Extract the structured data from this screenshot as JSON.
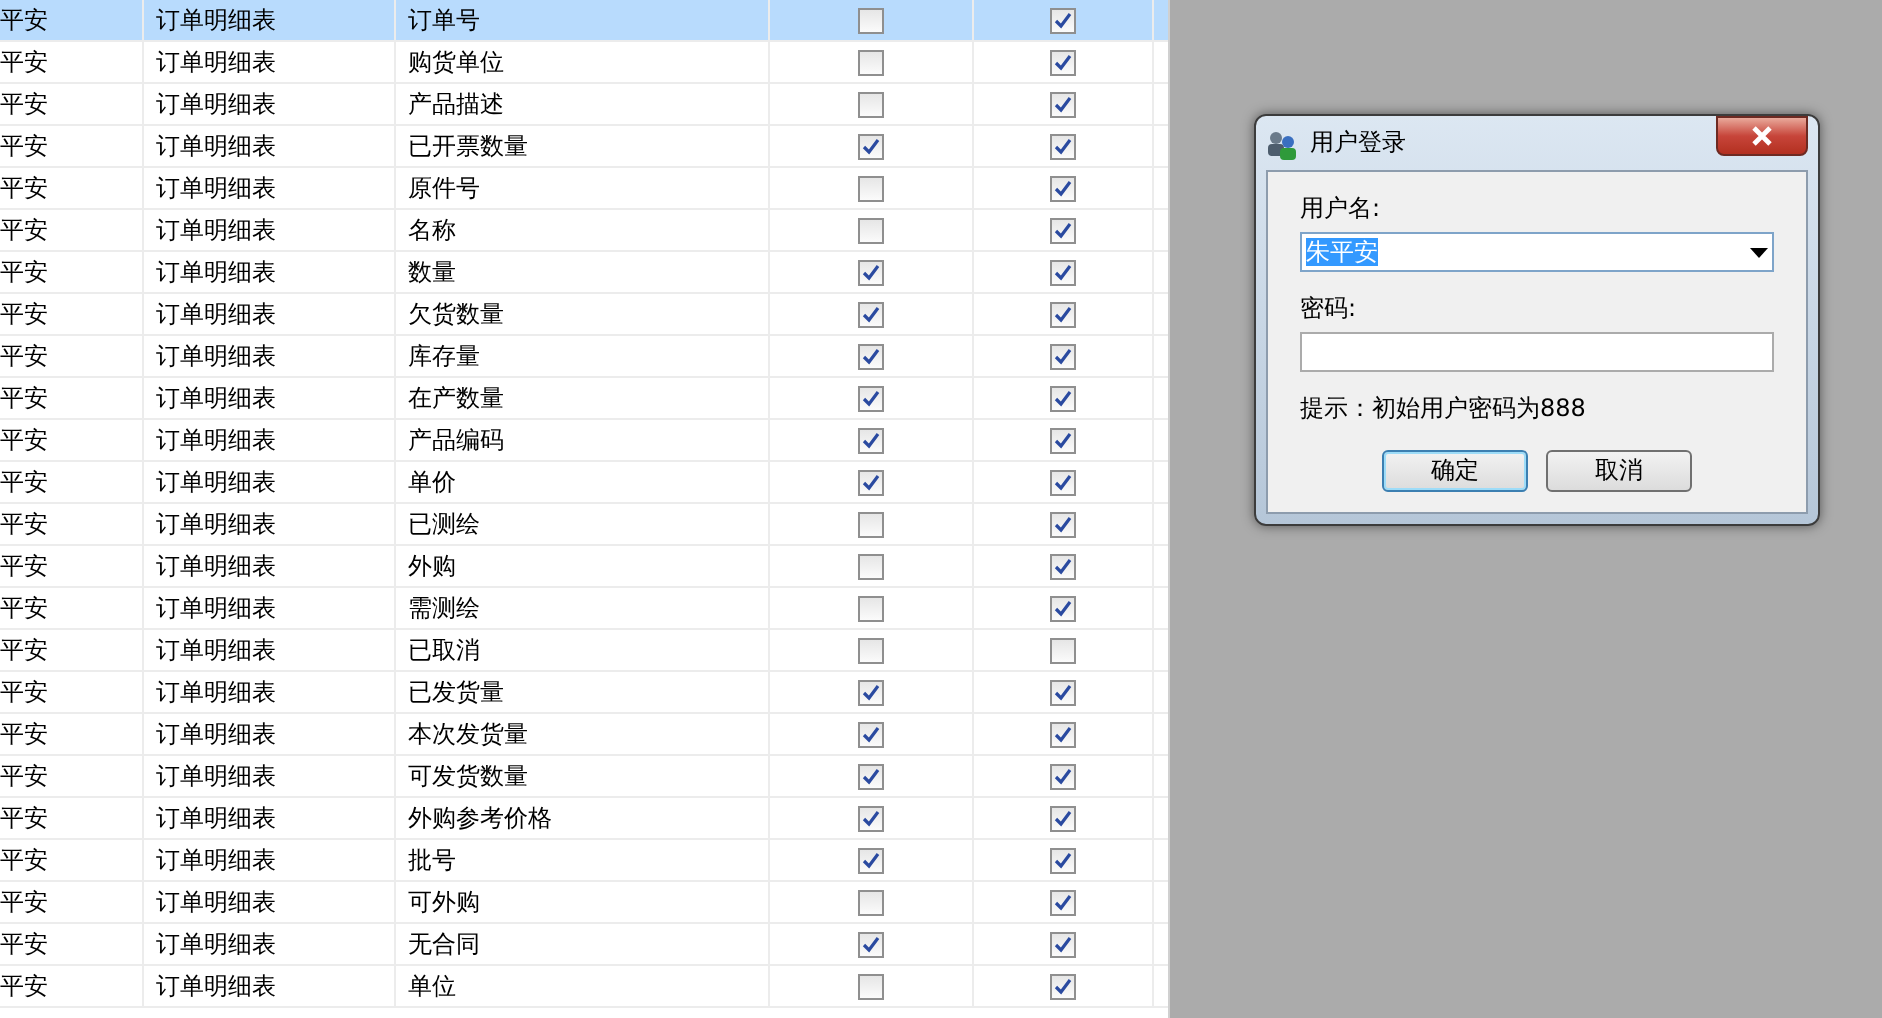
{
  "table": {
    "rows": [
      {
        "user": "平安",
        "table": "订单明细表",
        "field": "订单号",
        "check_1": false,
        "check_2": true,
        "selected": true
      },
      {
        "user": "平安",
        "table": "订单明细表",
        "field": "购货单位",
        "check_1": false,
        "check_2": true,
        "selected": false
      },
      {
        "user": "平安",
        "table": "订单明细表",
        "field": "产品描述",
        "check_1": false,
        "check_2": true,
        "selected": false
      },
      {
        "user": "平安",
        "table": "订单明细表",
        "field": "已开票数量",
        "check_1": true,
        "check_2": true,
        "selected": false
      },
      {
        "user": "平安",
        "table": "订单明细表",
        "field": "原件号",
        "check_1": false,
        "check_2": true,
        "selected": false
      },
      {
        "user": "平安",
        "table": "订单明细表",
        "field": "名称",
        "check_1": false,
        "check_2": true,
        "selected": false
      },
      {
        "user": "平安",
        "table": "订单明细表",
        "field": "数量",
        "check_1": true,
        "check_2": true,
        "selected": false
      },
      {
        "user": "平安",
        "table": "订单明细表",
        "field": "欠货数量",
        "check_1": true,
        "check_2": true,
        "selected": false
      },
      {
        "user": "平安",
        "table": "订单明细表",
        "field": "库存量",
        "check_1": true,
        "check_2": true,
        "selected": false
      },
      {
        "user": "平安",
        "table": "订单明细表",
        "field": "在产数量",
        "check_1": true,
        "check_2": true,
        "selected": false
      },
      {
        "user": "平安",
        "table": "订单明细表",
        "field": "产品编码",
        "check_1": true,
        "check_2": true,
        "selected": false
      },
      {
        "user": "平安",
        "table": "订单明细表",
        "field": "单价",
        "check_1": true,
        "check_2": true,
        "selected": false
      },
      {
        "user": "平安",
        "table": "订单明细表",
        "field": "已测绘",
        "check_1": false,
        "check_2": true,
        "selected": false
      },
      {
        "user": "平安",
        "table": "订单明细表",
        "field": "外购",
        "check_1": false,
        "check_2": true,
        "selected": false
      },
      {
        "user": "平安",
        "table": "订单明细表",
        "field": "需测绘",
        "check_1": false,
        "check_2": true,
        "selected": false
      },
      {
        "user": "平安",
        "table": "订单明细表",
        "field": "已取消",
        "check_1": false,
        "check_2": false,
        "selected": false
      },
      {
        "user": "平安",
        "table": "订单明细表",
        "field": "已发货量",
        "check_1": true,
        "check_2": true,
        "selected": false
      },
      {
        "user": "平安",
        "table": "订单明细表",
        "field": "本次发货量",
        "check_1": true,
        "check_2": true,
        "selected": false
      },
      {
        "user": "平安",
        "table": "订单明细表",
        "field": "可发货数量",
        "check_1": true,
        "check_2": true,
        "selected": false
      },
      {
        "user": "平安",
        "table": "订单明细表",
        "field": "外购参考价格",
        "check_1": true,
        "check_2": true,
        "selected": false
      },
      {
        "user": "平安",
        "table": "订单明细表",
        "field": "批号",
        "check_1": true,
        "check_2": true,
        "selected": false
      },
      {
        "user": "平安",
        "table": "订单明细表",
        "field": "可外购",
        "check_1": false,
        "check_2": true,
        "selected": false
      },
      {
        "user": "平安",
        "table": "订单明细表",
        "field": "无合同",
        "check_1": true,
        "check_2": true,
        "selected": false
      },
      {
        "user": "平安",
        "table": "订单明细表",
        "field": "单位",
        "check_1": false,
        "check_2": true,
        "selected": false
      }
    ]
  },
  "dialog": {
    "title": "用户登录",
    "username_label": "用户名:",
    "username_value": "朱平安",
    "username_value_selected": true,
    "password_label": "密码:",
    "hint": "提示：初始用户密码为888",
    "buttons": [
      {
        "label": "确定",
        "default": true
      },
      {
        "label": "取消",
        "default": false
      }
    ]
  }
}
